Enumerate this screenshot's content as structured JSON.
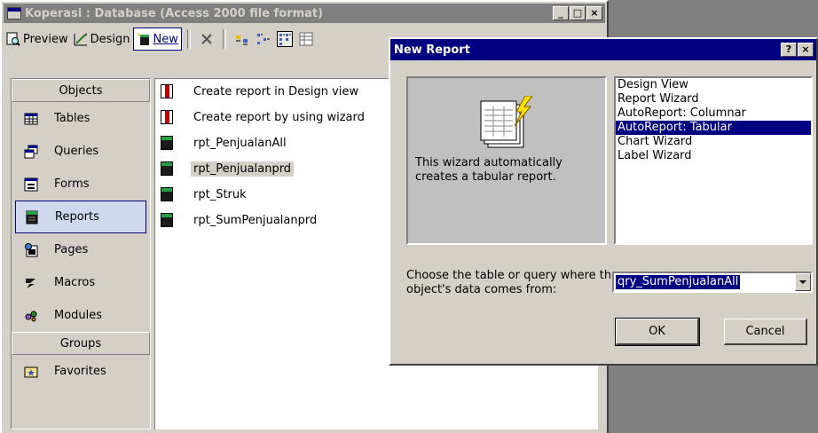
{
  "db_window": {
    "title": "Koperasi : Database (Access 2000 file format)",
    "caption_buttons": [
      "_",
      "□",
      "×"
    ]
  },
  "toolbar": {
    "preview_label": "Preview",
    "design_label": "Design",
    "new_label": "New"
  },
  "objects_bar": {
    "objects_header": "Objects",
    "items": [
      {
        "label": "Tables",
        "icon": "table-icon"
      },
      {
        "label": "Queries",
        "icon": "query-icon"
      },
      {
        "label": "Forms",
        "icon": "form-icon"
      },
      {
        "label": "Reports",
        "icon": "report-icon",
        "selected": true
      },
      {
        "label": "Pages",
        "icon": "page-icon"
      },
      {
        "label": "Macros",
        "icon": "macro-icon"
      },
      {
        "label": "Modules",
        "icon": "module-icon"
      }
    ],
    "groups_header": "Groups",
    "groups": [
      {
        "label": "Favorites",
        "icon": "favorites-icon"
      }
    ]
  },
  "list": {
    "items": [
      {
        "label": "Create report in Design view",
        "icon": "design-view-shortcut-icon"
      },
      {
        "label": "Create report by using wizard",
        "icon": "wizard-shortcut-icon"
      },
      {
        "label": "rpt_PenjualanAll",
        "icon": "report-icon"
      },
      {
        "label": "rpt_Penjualanprd",
        "icon": "report-icon",
        "selected": true
      },
      {
        "label": "rpt_Struk",
        "icon": "report-icon"
      },
      {
        "label": "rpt_SumPenjualanprd",
        "icon": "report-icon"
      }
    ]
  },
  "dialog": {
    "title": "New Report",
    "help_button": "?",
    "close_button": "×",
    "description": "This wizard automatically creates a tabular report.",
    "wizard_options": [
      "Design View",
      "Report Wizard",
      "AutoReport: Columnar",
      "AutoReport: Tabular",
      "Chart Wizard",
      "Label Wizard"
    ],
    "selected_option": "AutoReport: Tabular",
    "source_label": "Choose the table or query where the object's data comes from:",
    "source_value": "qry_SumPenjualanAll",
    "ok_label": "OK",
    "cancel_label": "Cancel"
  },
  "colors": {
    "face": "#d4d0c8",
    "active_title": "#000080",
    "inactive_title": "#808080",
    "selection": "#000080"
  }
}
